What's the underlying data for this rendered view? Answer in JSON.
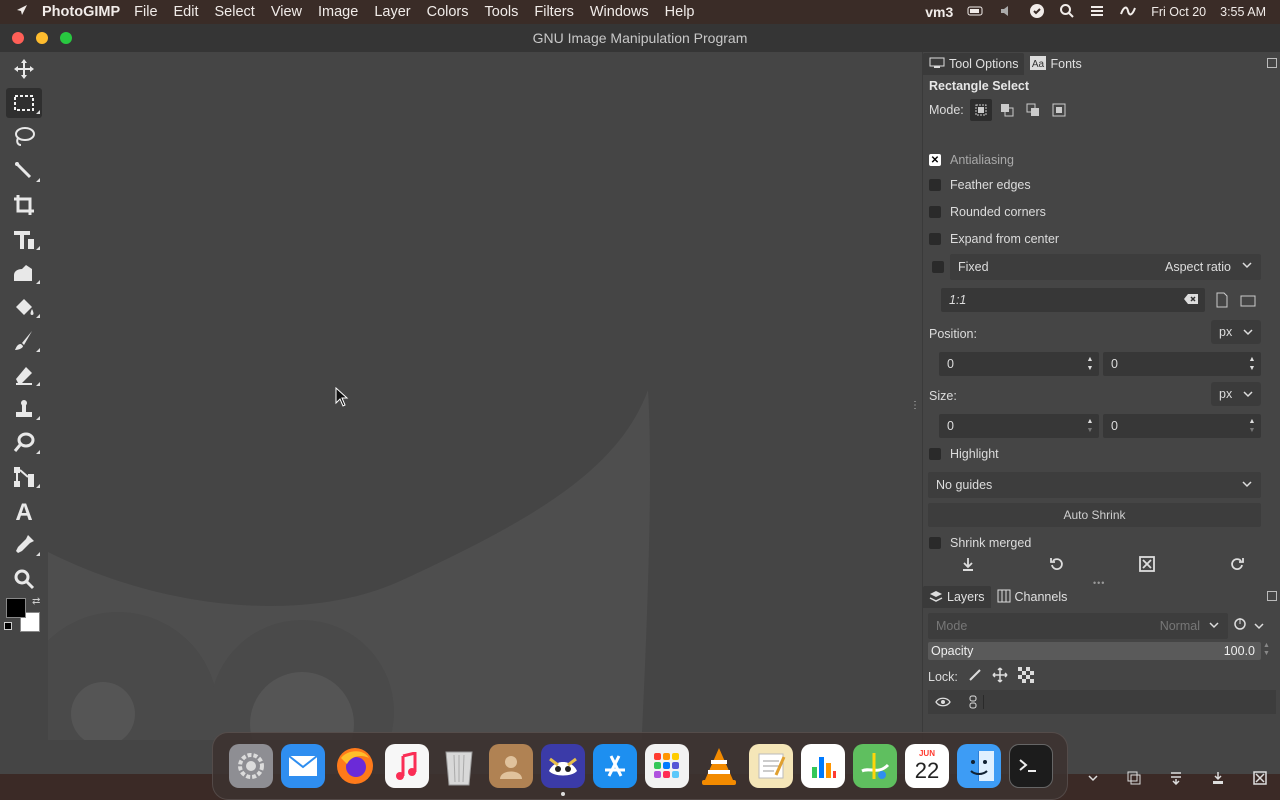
{
  "menubar": {
    "app_name": "PhotoGIMP",
    "items": [
      "File",
      "Edit",
      "Select",
      "View",
      "Image",
      "Layer",
      "Colors",
      "Tools",
      "Filters",
      "Windows",
      "Help"
    ],
    "status": {
      "user": "vm3",
      "date": "Fri Oct 20",
      "time": "3:55 AM"
    }
  },
  "window": {
    "title": "GNU Image Manipulation Program"
  },
  "toolbox": {
    "tools": [
      "move-tool",
      "rectangle-select-tool",
      "lasso-tool",
      "fuzzy-select-tool",
      "crop-tool",
      "unified-transform-tool",
      "warp-transform-tool",
      "bucket-fill-tool",
      "paintbrush-tool",
      "eraser-tool",
      "clone-tool",
      "smudge-tool",
      "paths-tool",
      "text-tool",
      "color-picker-tool",
      "zoom-tool"
    ],
    "active": "rectangle-select-tool"
  },
  "tool_options": {
    "tabs": [
      "Tool Options",
      "Fonts"
    ],
    "heading": "Rectangle Select",
    "mode_label": "Mode:",
    "antialiasing": "Antialiasing",
    "feather_edges": "Feather edges",
    "rounded_corners": "Rounded corners",
    "expand_from_center": "Expand from center",
    "fixed_label": "Fixed",
    "fixed_select": "Aspect ratio",
    "ratio_value": "1:1",
    "position_label": "Position:",
    "position_unit": "px",
    "position_x": "0",
    "position_y": "0",
    "size_label": "Size:",
    "size_unit": "px",
    "size_w": "0",
    "size_h": "0",
    "highlight": "Highlight",
    "guides": "No guides",
    "auto_shrink": "Auto Shrink",
    "shrink_merged": "Shrink merged"
  },
  "layers": {
    "tabs": [
      "Layers",
      "Channels"
    ],
    "mode_placeholder": "Mode",
    "mode_value": "Normal",
    "opacity_label": "Opacity",
    "opacity_value": "100.0",
    "lock_label": "Lock:"
  },
  "dock_apps": [
    {
      "name": "System Preferences",
      "color": "#8e8e93"
    },
    {
      "name": "Mail",
      "color": "#2f8ef0"
    },
    {
      "name": "Firefox",
      "color": "#ff7a1a"
    },
    {
      "name": "Music",
      "color": "#f7f7f7"
    },
    {
      "name": "Trash",
      "color": "#c9c9c9"
    },
    {
      "name": "Contacts",
      "color": "#b08253"
    },
    {
      "name": "PhotoGIMP",
      "color": "#3b3ba8"
    },
    {
      "name": "App Store",
      "color": "#1d8ff0"
    },
    {
      "name": "Launchpad",
      "color": "#f2f2f2"
    },
    {
      "name": "VLC",
      "color": "#f28a00"
    },
    {
      "name": "TextEdit",
      "color": "#f5e6b8"
    },
    {
      "name": "Numbers",
      "color": "#ffffff"
    },
    {
      "name": "Maps",
      "color": "#5fbf5f"
    },
    {
      "name": "Calendar",
      "color": "#ffffff"
    },
    {
      "name": "Finder",
      "color": "#3d9cf5"
    },
    {
      "name": "Terminal",
      "color": "#1c1c1c"
    }
  ],
  "calendar_icon": {
    "month": "JUN",
    "day": "22"
  }
}
